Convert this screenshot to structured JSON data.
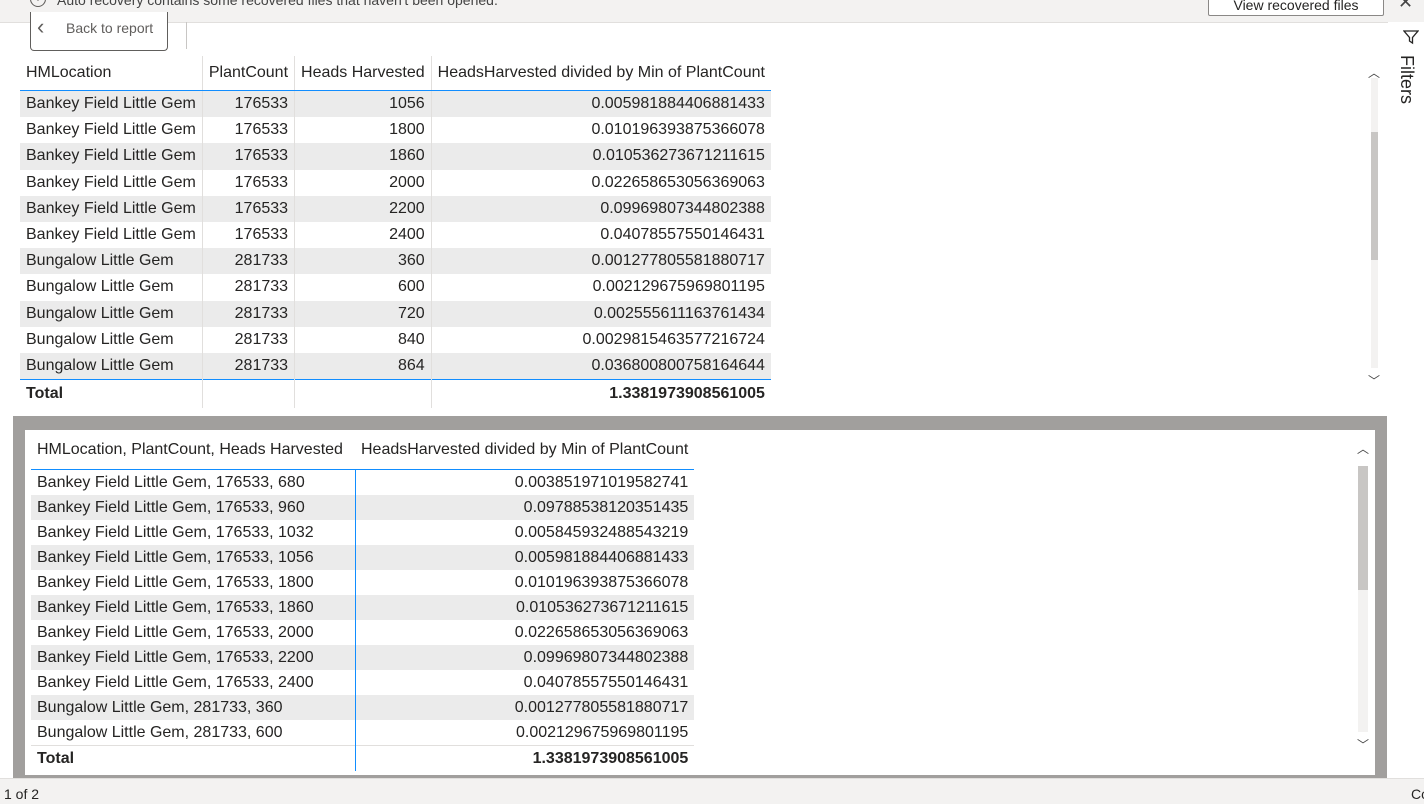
{
  "notification": {
    "message": "Auto recovery contains some recovered files that haven't been opened.",
    "view_button": "View recovered files",
    "info_icon": "info-icon",
    "close_icon": "close-icon"
  },
  "back_button": {
    "label": "Back to report",
    "icon": "chevron-left-icon"
  },
  "filters_pane": {
    "label": "Filters",
    "icon": "funnel-icon"
  },
  "table1": {
    "headers": [
      "HMLocation",
      "PlantCount",
      "Heads Harvested",
      "HeadsHarvested divided by Min of PlantCount"
    ],
    "rows": [
      [
        "Bankey Field Little Gem",
        "176533",
        "1056",
        "0.005981884406881433"
      ],
      [
        "Bankey Field Little Gem",
        "176533",
        "1800",
        "0.010196393875366078"
      ],
      [
        "Bankey Field Little Gem",
        "176533",
        "1860",
        "0.010536273671211615"
      ],
      [
        "Bankey Field Little Gem",
        "176533",
        "2000",
        "0.022658653056369063"
      ],
      [
        "Bankey Field Little Gem",
        "176533",
        "2200",
        "0.09969807344802388"
      ],
      [
        "Bankey Field Little Gem",
        "176533",
        "2400",
        "0.04078557550146431"
      ],
      [
        "Bungalow Little Gem",
        "281733",
        "360",
        "0.001277805581880717"
      ],
      [
        "Bungalow Little Gem",
        "281733",
        "600",
        "0.002129675969801195"
      ],
      [
        "Bungalow Little Gem",
        "281733",
        "720",
        "0.002555611163761434"
      ],
      [
        "Bungalow Little Gem",
        "281733",
        "840",
        "0.0029815463577216724"
      ],
      [
        "Bungalow Little Gem",
        "281733",
        "864",
        "0.036800800758164644"
      ]
    ],
    "total_label": "Total",
    "total_value": "1.3381973908561005"
  },
  "table2": {
    "headers": [
      "HMLocation, PlantCount, Heads Harvested",
      "HeadsHarvested divided by Min of PlantCount"
    ],
    "rows": [
      [
        "Bankey Field Little Gem, 176533, 680",
        "0.003851971019582741"
      ],
      [
        "Bankey Field Little Gem, 176533, 960",
        "0.09788538120351435"
      ],
      [
        "Bankey Field Little Gem, 176533, 1032",
        "0.005845932488543219"
      ],
      [
        "Bankey Field Little Gem, 176533, 1056",
        "0.005981884406881433"
      ],
      [
        "Bankey Field Little Gem, 176533, 1800",
        "0.010196393875366078"
      ],
      [
        "Bankey Field Little Gem, 176533, 1860",
        "0.010536273671211615"
      ],
      [
        "Bankey Field Little Gem, 176533, 2000",
        "0.022658653056369063"
      ],
      [
        "Bankey Field Little Gem, 176533, 2200",
        "0.09969807344802388"
      ],
      [
        "Bankey Field Little Gem, 176533, 2400",
        "0.04078557550146431"
      ],
      [
        "Bungalow Little Gem, 281733, 360",
        "0.001277805581880717"
      ],
      [
        "Bungalow Little Gem, 281733, 600",
        "0.002129675969801195"
      ]
    ],
    "total_label": "Total",
    "total_value": "1.3381973908561005"
  },
  "status_bar": {
    "page": "1 of 2",
    "right_text": "Cc"
  },
  "colors": {
    "accent": "#118dff",
    "alt_row": "#ebebeb",
    "frame": "#a19f9d"
  }
}
